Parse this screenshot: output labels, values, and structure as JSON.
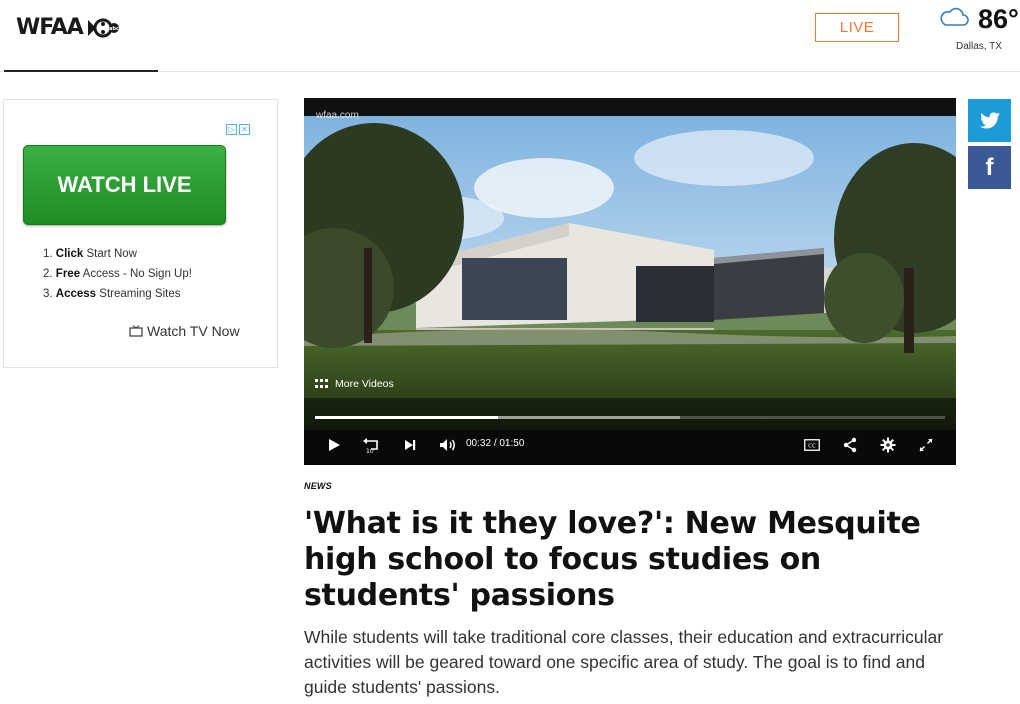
{
  "header": {
    "logo_text": "WFAA",
    "live_label": "LIVE",
    "weather": {
      "temp": "86°",
      "location": "Dallas, TX",
      "icon": "cloud-icon"
    }
  },
  "ad": {
    "choices": [
      "▷",
      "✕"
    ],
    "watch_live_label": "WATCH LIVE",
    "steps": [
      {
        "num": "1.",
        "bold": "Click",
        "rest": " Start Now"
      },
      {
        "num": "2.",
        "bold": "Free",
        "rest": " Access - No Sign Up!"
      },
      {
        "num": "3.",
        "bold": "Access",
        "rest": " Streaming Sites"
      }
    ],
    "watch_tv_label": "Watch TV Now"
  },
  "video": {
    "watermark": "wfaa.com",
    "more_videos_label": "More Videos",
    "played_fraction": 0.29,
    "buffered_fraction": 0.58,
    "current_time": "00:32",
    "time_separator": "/",
    "duration": "01:50"
  },
  "social": {
    "twitter_icon": "twitter-bird-icon",
    "facebook_label": "f"
  },
  "article": {
    "category": "NEWS",
    "headline": "'What is it they love?': New Mesquite high school to focus studies on students' passions",
    "summary": "While students will take traditional core classes, their education and extracurricular activities will be geared toward one specific area of study. The goal is to find and guide students' passions."
  },
  "colors": {
    "live_accent": "#e87b3a",
    "ad_button_green": "#2ea336",
    "twitter_blue": "#1d9bd9",
    "facebook_blue": "#3b5998"
  }
}
